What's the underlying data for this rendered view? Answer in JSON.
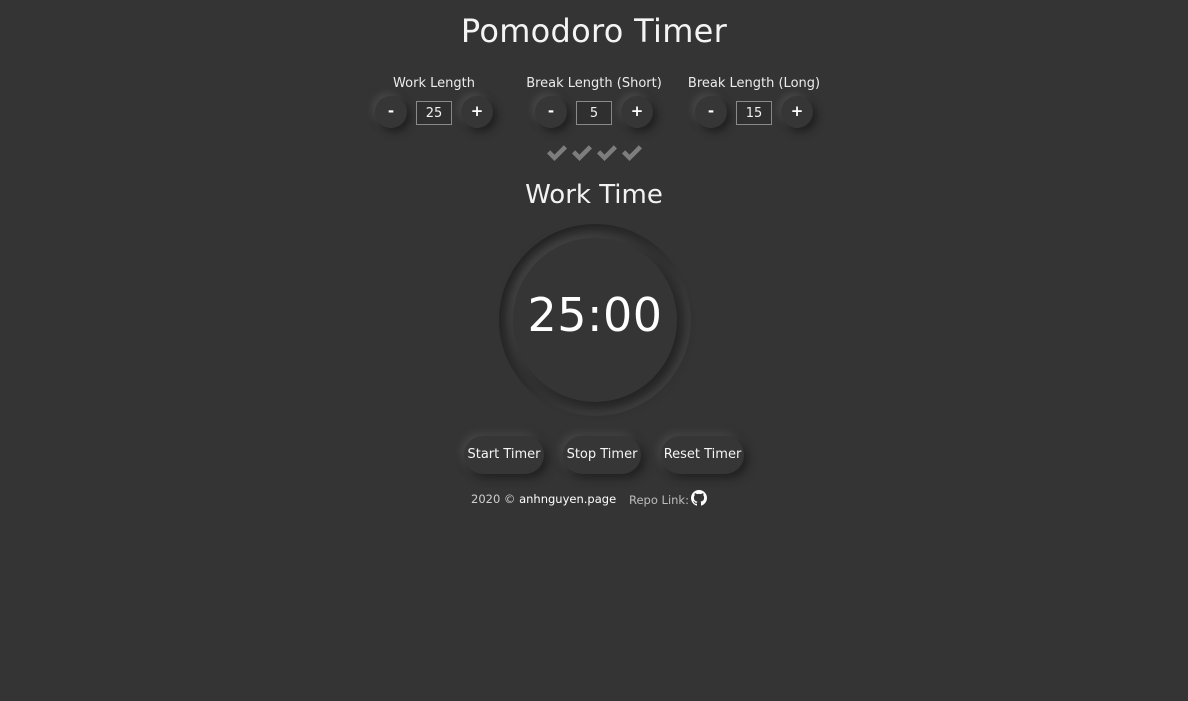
{
  "app": {
    "title": "Pomodoro Timer"
  },
  "settings": {
    "work": {
      "label": "Work Length",
      "value": "25",
      "decrement_label": "-",
      "increment_label": "+"
    },
    "short_break": {
      "label": "Break Length (Short)",
      "value": "5",
      "decrement_label": "-",
      "increment_label": "+"
    },
    "long_break": {
      "label": "Break Length (Long)",
      "value": "15",
      "decrement_label": "-",
      "increment_label": "+"
    }
  },
  "progress": {
    "checkmarks": 4,
    "icon": "check-icon",
    "color": "#7d7d7d"
  },
  "timer": {
    "phase": "Work Time",
    "display": "25:00"
  },
  "actions": {
    "start_label": "Start Timer",
    "stop_label": "Stop Timer",
    "reset_label": "Reset Timer"
  },
  "footer": {
    "copyright_prefix": "2020 ©",
    "site_link": "anhnguyen.page",
    "repo_label": "Repo Link:",
    "repo_icon": "github-icon"
  },
  "colors": {
    "background": "#343434",
    "text": "#f2f2f2"
  }
}
